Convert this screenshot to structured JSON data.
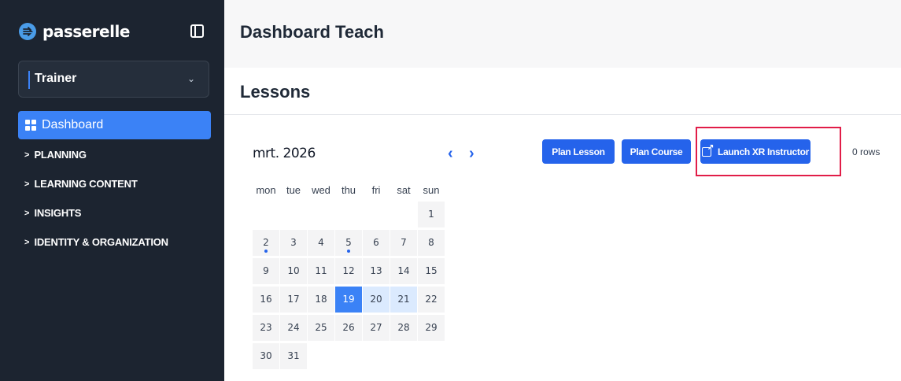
{
  "sidebar": {
    "brand": "passerelle",
    "role_selector": {
      "value": "Trainer"
    },
    "nav": {
      "active": {
        "label": "Dashboard",
        "icon": "dashboard-grid-icon"
      },
      "items": [
        {
          "label": "PLANNING"
        },
        {
          "label": "LEARNING CONTENT"
        },
        {
          "label": "INSIGHTS"
        },
        {
          "label": "IDENTITY & ORGANIZATION"
        }
      ]
    }
  },
  "header": {
    "title": "Dashboard Teach"
  },
  "lessons": {
    "title": "Lessons",
    "calendar": {
      "month_label": "mrt. 2026",
      "weekdays": [
        "mon",
        "tue",
        "wed",
        "thu",
        "fri",
        "sat",
        "sun"
      ],
      "weeks": [
        [
          "",
          "",
          "",
          "",
          "",
          "",
          "1"
        ],
        [
          "2",
          "3",
          "4",
          "5",
          "6",
          "7",
          "8"
        ],
        [
          "9",
          "10",
          "11",
          "12",
          "13",
          "14",
          "15"
        ],
        [
          "16",
          "17",
          "18",
          "19",
          "20",
          "21",
          "22"
        ],
        [
          "23",
          "24",
          "25",
          "26",
          "27",
          "28",
          "29"
        ],
        [
          "30",
          "31",
          "",
          "",
          "",
          "",
          ""
        ]
      ],
      "selected_day": "19",
      "highlighted_days": [
        "20",
        "21"
      ],
      "days_with_events": [
        "2",
        "5"
      ]
    },
    "actions": {
      "plan_lesson": "Plan Lesson",
      "plan_course": "Plan Course",
      "launch_xr": "Launch XR Instructor"
    },
    "rows_count": "0 rows"
  },
  "colors": {
    "sidebar_bg": "#1c2430",
    "accent": "#3b82f6",
    "button": "#2563eb",
    "highlight_outline": "#e11d48"
  }
}
